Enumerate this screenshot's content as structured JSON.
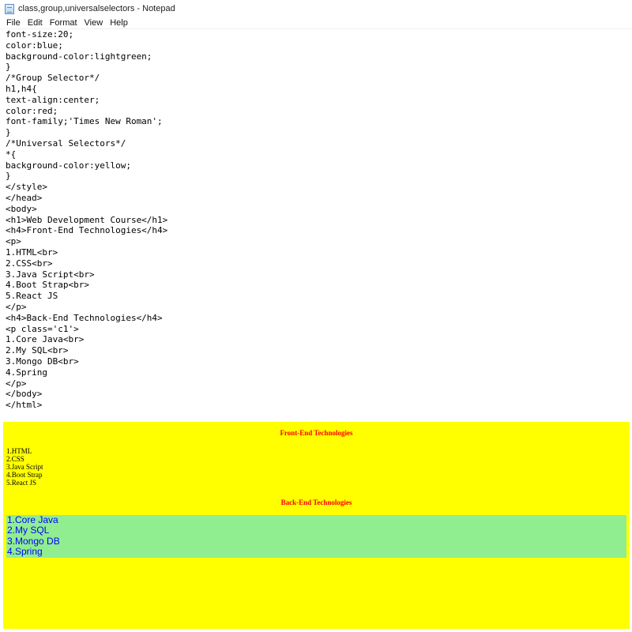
{
  "window": {
    "title": "class,group,universalselectors - Notepad"
  },
  "menu": [
    "File",
    "Edit",
    "Format",
    "View",
    "Help"
  ],
  "editor": {
    "lines": [
      "font-size:20;",
      "color:blue;",
      "background-color:lightgreen;",
      "}",
      "/*Group Selector*/",
      "h1,h4{",
      "text-align:center;",
      "color:red;",
      "font-family;'Times New Roman';",
      "}",
      "/*Universal Selectors*/",
      "*{",
      "background-color:yellow;",
      "}",
      "</style>",
      "</head>",
      "<body>",
      "<h1>Web Development Course</h1>",
      "<h4>Front-End Technologies</h4>",
      "<p>",
      "1.HTML<br>",
      "2.CSS<br>",
      "3.Java Script<br>",
      "4.Boot Strap<br>",
      "5.React JS",
      "</p>",
      "<h4>Back-End Technologies</h4>",
      "<p class='c1'>",
      "1.Core Java<br>",
      "2.My SQL<br>",
      "3.Mongo DB<br>",
      "4.Spring",
      "</p>",
      "</body>",
      "</html>"
    ]
  },
  "render": {
    "frontend_heading": "Front-End Technologies",
    "frontend_items": [
      "1.HTML",
      "2.CSS",
      "3.Java Script",
      "4.Boot Strap",
      "5.React JS"
    ],
    "backend_heading": "Back-End Technologies",
    "backend_items": [
      "1.Core Java",
      "2.My SQL",
      "3.Mongo DB",
      "4.Spring"
    ]
  }
}
